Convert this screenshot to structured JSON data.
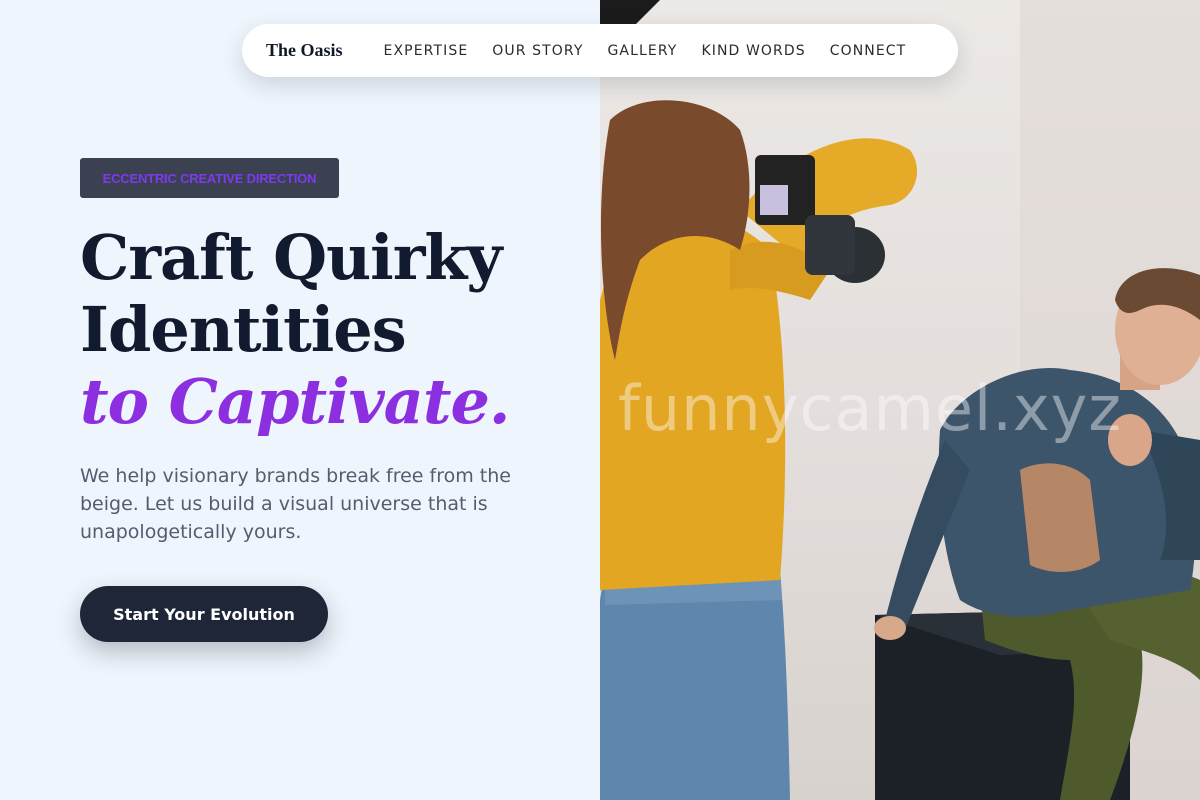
{
  "nav": {
    "brand": "The Oasis",
    "links": [
      "EXPERTISE",
      "OUR STORY",
      "GALLERY",
      "KIND WORDS",
      "CONNECT"
    ]
  },
  "hero": {
    "eyebrow": "ECCENTRIC CREATIVE DIRECTION",
    "headline_line1": "Craft Quirky",
    "headline_line2": "Identities",
    "headline_accent": "to Captivate.",
    "subtext": "We help visionary brands break free from the beige. Let us build a visual universe that is unapologetically yours.",
    "cta_label": "Start Your Evolution"
  },
  "photo": {
    "alt": "Photographer in a yellow sweater photographing a man in a denim jacket seated on a black box",
    "watermark": "funnycamel.xyz"
  },
  "colors": {
    "accent": "#8b2fe0",
    "dark": "#1e2638",
    "background": "#eef5fc"
  }
}
